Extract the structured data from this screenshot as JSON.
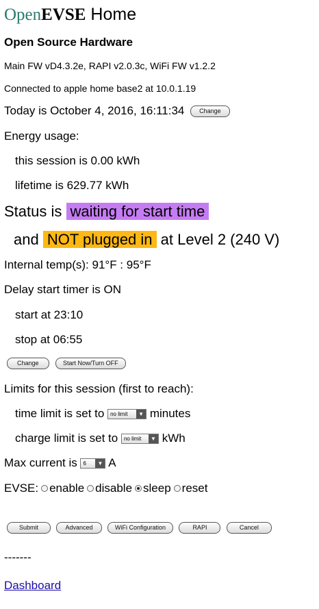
{
  "header": {
    "title_open": "Open",
    "title_evse": "EVSE",
    "title_home": "Home",
    "subtitle": "Open Source Hardware",
    "firmware": "Main FW vD4.3.2e, RAPI v2.0.3c, WiFi FW v1.2.2",
    "connection": "Connected to apple home base2 at 10.0.1.19"
  },
  "datetime": {
    "text": "Today is October 4, 2016, 16:11:34",
    "change_label": "Change"
  },
  "energy": {
    "heading": "Energy usage:",
    "session": "this session is 0.00 kWh",
    "lifetime": "lifetime is 629.77 kWh"
  },
  "status": {
    "prefix": "Status is",
    "state": "waiting for start time",
    "and": "and",
    "plug_state": "NOT plugged in",
    "level": "at Level 2 (240 V)",
    "colors": {
      "state_bg": "#c57cf3",
      "plug_bg": "#fdb813"
    }
  },
  "temps": "Internal temp(s): 91°F : 95°F",
  "timer": {
    "status": "Delay start timer is ON",
    "start": "start at 23:10",
    "stop": "stop at 06:55",
    "change_label": "Change",
    "start_now_label": "Start Now/Turn OFF"
  },
  "limits": {
    "heading": "Limits for this session (first to reach):",
    "time_prefix": "time limit is set to",
    "time_value": "no limit",
    "time_unit": "minutes",
    "charge_prefix": "charge limit is set to",
    "charge_value": "no limit",
    "charge_unit": "kWh"
  },
  "current": {
    "prefix": "Max current is",
    "value": "6",
    "unit": "A"
  },
  "evse": {
    "label": "EVSE:",
    "options": [
      "enable",
      "disable",
      "sleep",
      "reset"
    ],
    "selected": "sleep"
  },
  "buttons": {
    "submit": "Submit",
    "advanced": "Advanced",
    "wifi": "WiFi Configuration",
    "rapi": "RAPI",
    "cancel": "Cancel"
  },
  "footer": {
    "separator": "-------",
    "dashboard": "Dashboard"
  }
}
